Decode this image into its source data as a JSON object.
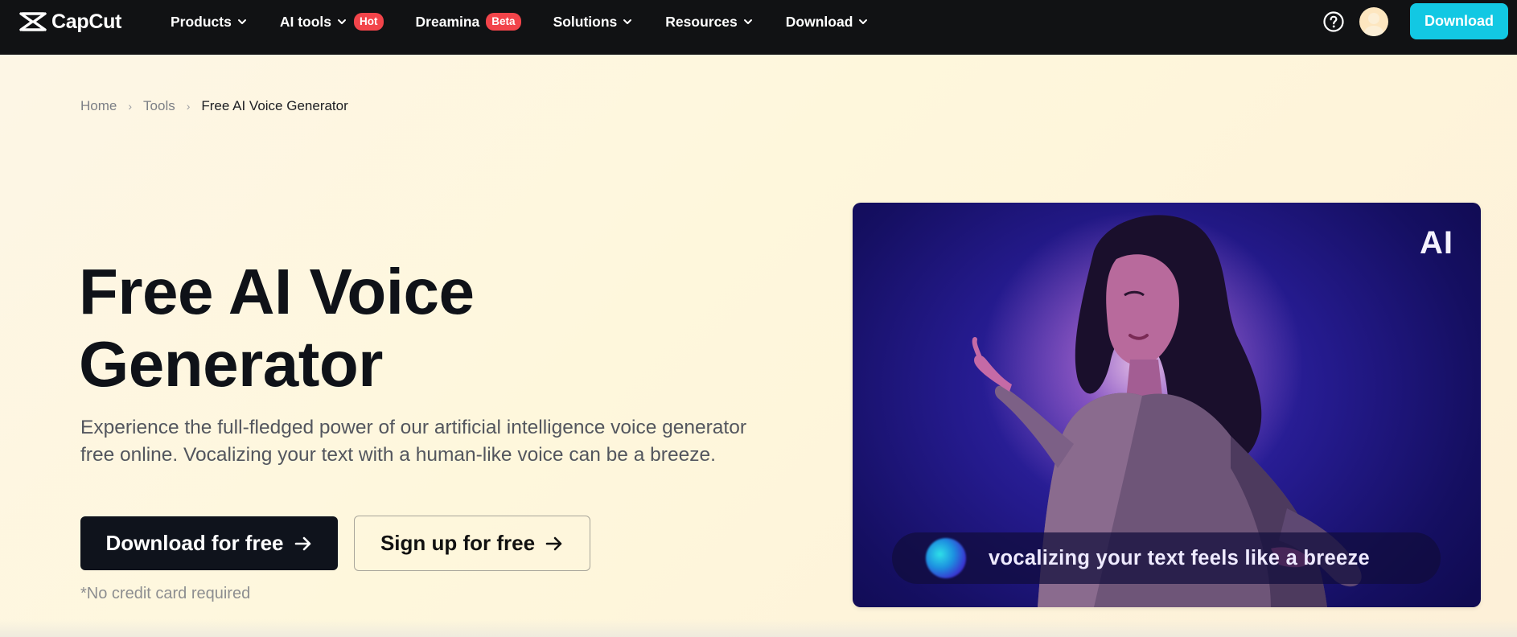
{
  "nav": {
    "logo_text": "CapCut",
    "items": [
      {
        "label": "Products",
        "badge": "",
        "has_dropdown": true
      },
      {
        "label": "AI tools",
        "badge": "Hot",
        "has_dropdown": true
      },
      {
        "label": "Dreamina",
        "badge": "Beta",
        "has_dropdown": false
      },
      {
        "label": "Solutions",
        "badge": "",
        "has_dropdown": true
      },
      {
        "label": "Resources",
        "badge": "",
        "has_dropdown": true
      },
      {
        "label": "Download",
        "badge": "",
        "has_dropdown": true
      }
    ],
    "download_label": "Download",
    "icons": {
      "help": "help-circle-icon",
      "avatar": "user-avatar",
      "logo": "capcut-logo-icon"
    },
    "accent_color": "#12c8e3",
    "badge_color": "#f2444a"
  },
  "breadcrumb": {
    "items": [
      "Home",
      "Tools",
      "Free AI Voice Generator"
    ]
  },
  "hero": {
    "title": "Free AI Voice Generator",
    "description": "Experience the full-fledged power of our artificial intelligence voice generator free online. Vocalizing your text with a human-like voice can be a breeze.",
    "primary_button": "Download for free",
    "secondary_button": "Sign up for free",
    "note": "*No credit card required"
  },
  "media": {
    "corner_label": "AI",
    "caption": "vocalizing your text feels like a breeze"
  }
}
